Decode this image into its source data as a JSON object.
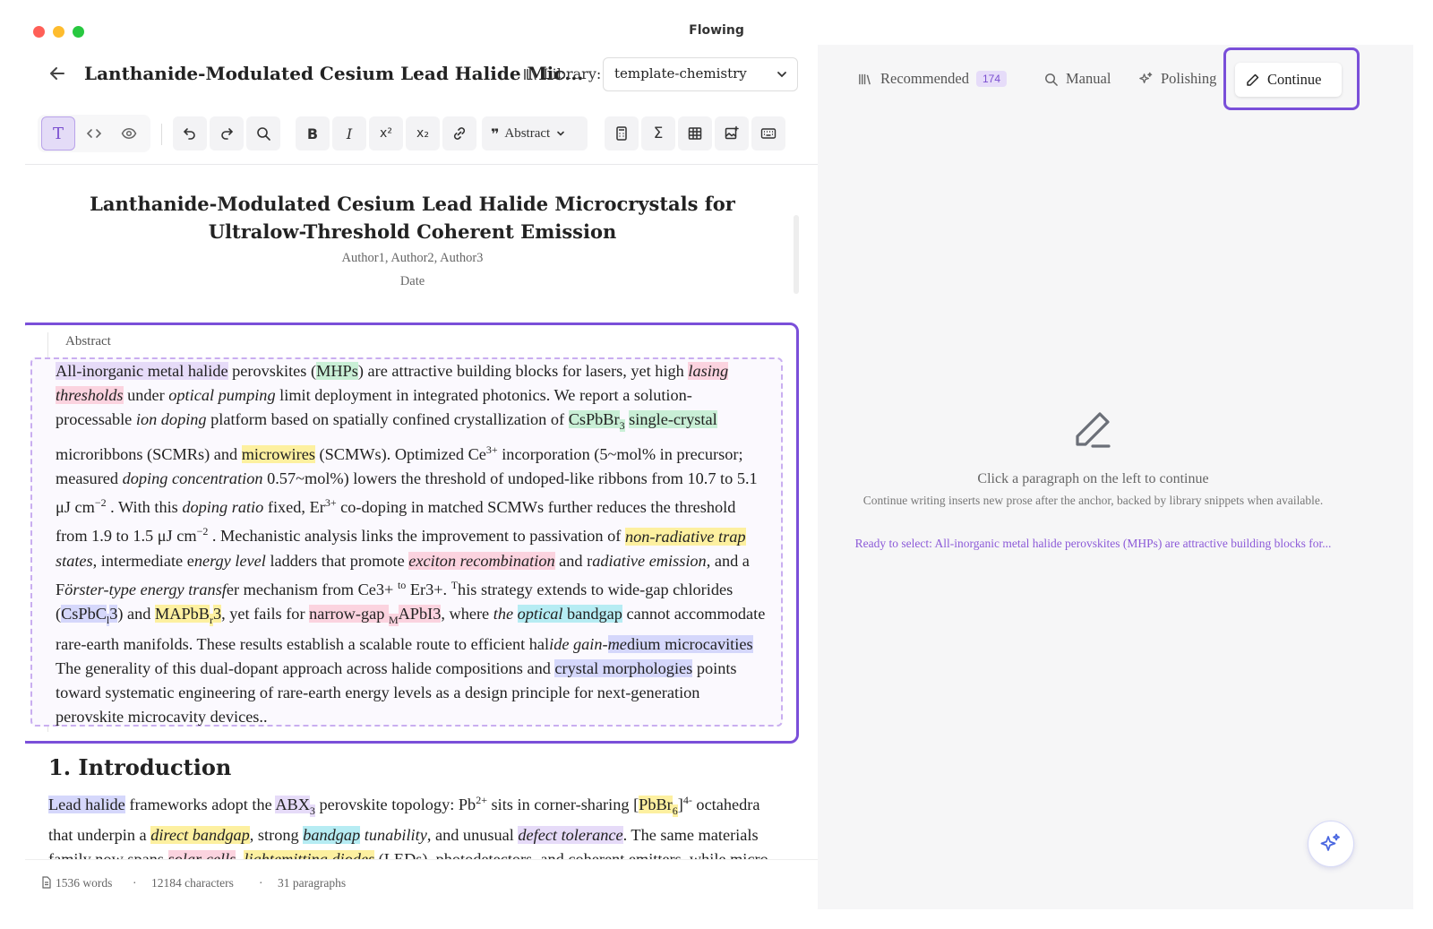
{
  "app": {
    "title": "Flowing"
  },
  "editor": {
    "doc_title": "Lanthanide-Modulated Cesium Lead Halide Mic...",
    "library_label": "Library:",
    "library_value": "template-chemistry",
    "toolbar": {
      "block_style": "Abstract"
    },
    "paper": {
      "title": "Lanthanide-Modulated Cesium Lead Halide Microcrystals for Ultralow-Threshold Coherent Emission",
      "authors": "Author1, Author2, Author3",
      "date": "Date",
      "abstract_label": "Abstract",
      "intro_heading": "1. Introduction"
    },
    "status": {
      "words": "1536 words",
      "characters": "12184 characters",
      "paragraphs": "31 paragraphs"
    }
  },
  "panel": {
    "tabs": {
      "recommended": "Recommended",
      "recommended_count": "174",
      "manual": "Manual",
      "polishing": "Polishing",
      "continue": "Continue"
    },
    "empty_title": "Click a paragraph on the left to continue",
    "empty_desc": "Continue writing inserts new prose after the anchor, backed by library snippets when available.",
    "ready_text": "Ready to select: All-inorganic metal halide perovskites (MHPs) are attractive building blocks for..."
  },
  "colors": {
    "accent": "#7a4fd9",
    "link": "#8c5ad8"
  },
  "abstract_runs": [
    {
      "t": "All-inorganic metal halide",
      "c": "purple"
    },
    {
      "t": " perovskites ("
    },
    {
      "t": "MHPs",
      "c": "green"
    },
    {
      "t": ") are attractive building blocks for lasers, yet high "
    },
    {
      "t": "lasing thresholds",
      "c": "pink",
      "i": true
    },
    {
      "t": " under "
    },
    {
      "t": "optical pumping",
      "i": true
    },
    {
      "t": " limit deployment in integrated photonics. We report a solution-processable "
    },
    {
      "t": "ion doping",
      "i": true
    },
    {
      "t": " platform based on spatially confined crystallization of "
    },
    {
      "t": "CsPbBr",
      "c": "green"
    },
    {
      "t": "3",
      "c": "green",
      "sub": true
    },
    {
      "t": " "
    },
    {
      "t": "single-crystal",
      "c": "green"
    },
    {
      "t": " microribbons (SCMRs) and "
    },
    {
      "t": "microwires",
      "c": "yellow"
    },
    {
      "t": " (SCMWs). Optimized Ce"
    },
    {
      "t": "3+",
      "sup": true
    },
    {
      "t": " incorporation (5~mol% in precursor; measured "
    },
    {
      "t": "doping concentration",
      "i": true
    },
    {
      "t": " 0.57~mol%) lowers the threshold of undoped-like ribbons from  10.7  to  5.1 μJ cm"
    },
    {
      "t": "−2",
      "sup": true
    },
    {
      "t": " . With this "
    },
    {
      "t": "doping ratio",
      "i": true
    },
    {
      "t": " fixed, Er"
    },
    {
      "t": "3+",
      "sup": true
    },
    {
      "t": " co-doping in matched SCMWs further reduces the threshold from  1.9  to  1.5 μJ cm"
    },
    {
      "t": "−2",
      "sup": true
    },
    {
      "t": " . Mechanistic analysis links the improvement to passivation of "
    },
    {
      "t": "non-radiative trap",
      "c": "yellow",
      "i": true
    },
    {
      "t": " states",
      "i": true
    },
    {
      "t": ", intermediate e"
    },
    {
      "t": "nergy level",
      "i": true
    },
    {
      "t": " ladders that promote "
    },
    {
      "t": "exciton recombination",
      "c": "pink",
      "i": true
    },
    {
      "t": " and r"
    },
    {
      "t": "adiative emission",
      "i": true
    },
    {
      "t": ", and a F"
    },
    {
      "t": "örster-type energy transf",
      "i": true
    },
    {
      "t": "er mechanism from Ce3+ "
    },
    {
      "t": "to",
      "sup": true
    },
    {
      "t": " Er3+. "
    },
    {
      "t": "T",
      "sup": true
    },
    {
      "t": "his strategy extends to wide-gap chlorides ("
    },
    {
      "t": "CsPbC",
      "c": "blue"
    },
    {
      "t": "l",
      "c": "blue",
      "sub": true
    },
    {
      "t": "3",
      "c": "blue"
    },
    {
      "t": ") and "
    },
    {
      "t": "MAPbB",
      "c": "yellow"
    },
    {
      "t": "r",
      "c": "yellow",
      "sub": true
    },
    {
      "t": "3",
      "c": "yellow"
    },
    {
      "t": ", yet fails for "
    },
    {
      "t": "narrow-gap ",
      "c": "pink"
    },
    {
      "t": "M",
      "c": "pink",
      "sub": true
    },
    {
      "t": "APbI3",
      "c": "pink"
    },
    {
      "t": ", where "
    },
    {
      "t": "the ",
      "i": true
    },
    {
      "t": "optical ",
      "c": "cyan",
      "i": true
    },
    {
      "t": "bandgap",
      "c": "cyan"
    },
    {
      "t": " cannot accommodate rare-earth manifolds. These results establish a scalable route to efficient hal"
    },
    {
      "t": "ide gain-",
      "i": true
    },
    {
      "t": "me",
      "c": "blue",
      "i": true
    },
    {
      "t": "dium microcavities",
      "c": "blue"
    },
    {
      "t": " The generality of this dual-dopant approach across halide compositions and "
    },
    {
      "t": "crystal morphologies",
      "c": "blue"
    },
    {
      "t": " points toward systematic engineering of rare-earth energy levels as a design principle for next-generation perovskite microcavity devices.."
    }
  ],
  "intro_runs": [
    {
      "t": "Lead halide",
      "c": "blue"
    },
    {
      "t": " frameworks adopt the "
    },
    {
      "t": "ABX",
      "c": "purple"
    },
    {
      "t": "3",
      "c": "purple",
      "sub": true
    },
    {
      "t": " perovskite topology: Pb"
    },
    {
      "t": "2+",
      "sup": true
    },
    {
      "t": " sits in corner-sharing ["
    },
    {
      "t": "PbBr",
      "c": "yellow"
    },
    {
      "t": "6",
      "c": "yellow",
      "sub": true
    },
    {
      "t": "]"
    },
    {
      "t": "4-",
      "sup": true
    },
    {
      "t": " octahedra that underpin a "
    },
    {
      "t": "direct bandgap",
      "c": "yellow",
      "i": true
    },
    {
      "t": ", strong "
    },
    {
      "t": "bandgap",
      "c": "cyan",
      "i": true
    },
    {
      "t": " tunability",
      "i": true
    },
    {
      "t": ", and unusual "
    },
    {
      "t": "defect tolerance",
      "c": "purple",
      "i": true
    },
    {
      "t": ". The same materials family now spans "
    },
    {
      "t": "solar cells",
      "c": "pink",
      "i": true
    },
    {
      "t": ", "
    },
    {
      "t": "lightemitting diodes",
      "c": "yellow",
      "i": true
    },
    {
      "t": " (LEDs), photodetectors, and coherent emitters, while micro- and nano-cavities promise compact sources"
    }
  ]
}
